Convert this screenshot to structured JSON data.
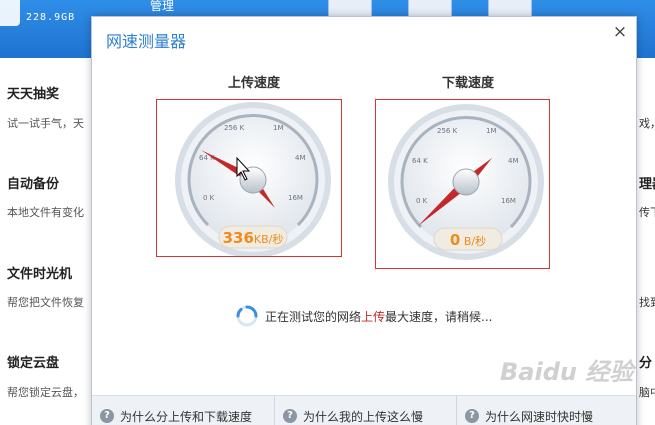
{
  "background": {
    "storage_text": "228.9GB",
    "top_word": "管理",
    "features": [
      {
        "title": "天天抽奖",
        "desc": "试一试手气，天"
      },
      {
        "title": "自动备份",
        "desc": "本地文件有变化"
      },
      {
        "title": "文件时光机",
        "desc": "帮您把文件恢复"
      },
      {
        "title": "锁定云盘",
        "desc": "帮您锁定云盘，"
      }
    ],
    "right_fragments": [
      "戏，",
      "理器",
      "传下",
      "找到",
      "分",
      "脑中"
    ]
  },
  "dialog": {
    "title": "网速测量器",
    "close_glyph": "×",
    "upload": {
      "label": "上传速度",
      "value": "336",
      "unit": "KB/秒",
      "tick_labels": [
        "0 K",
        "64 K",
        "256 K",
        "1M",
        "4M",
        "16M"
      ]
    },
    "download": {
      "label": "下载速度",
      "value": "0",
      "unit": "B/秒",
      "tick_labels": [
        "0 K",
        "64 K",
        "256 K",
        "1M",
        "4M",
        "16M"
      ]
    },
    "status": {
      "prefix": "正在测试您的网络",
      "highlight": "上传",
      "suffix": "最大速度，请稍候..."
    },
    "faq": [
      "为什么分上传和下载速度",
      "为什么我的上传这么慢",
      "为什么网速时快时慢"
    ]
  },
  "watermark": "Baidu 经验",
  "colors": {
    "title_blue": "#2d7fd1",
    "needle_red": "#c3282a",
    "speed_orange": "#f08a1c",
    "frame_red": "#d43434"
  }
}
